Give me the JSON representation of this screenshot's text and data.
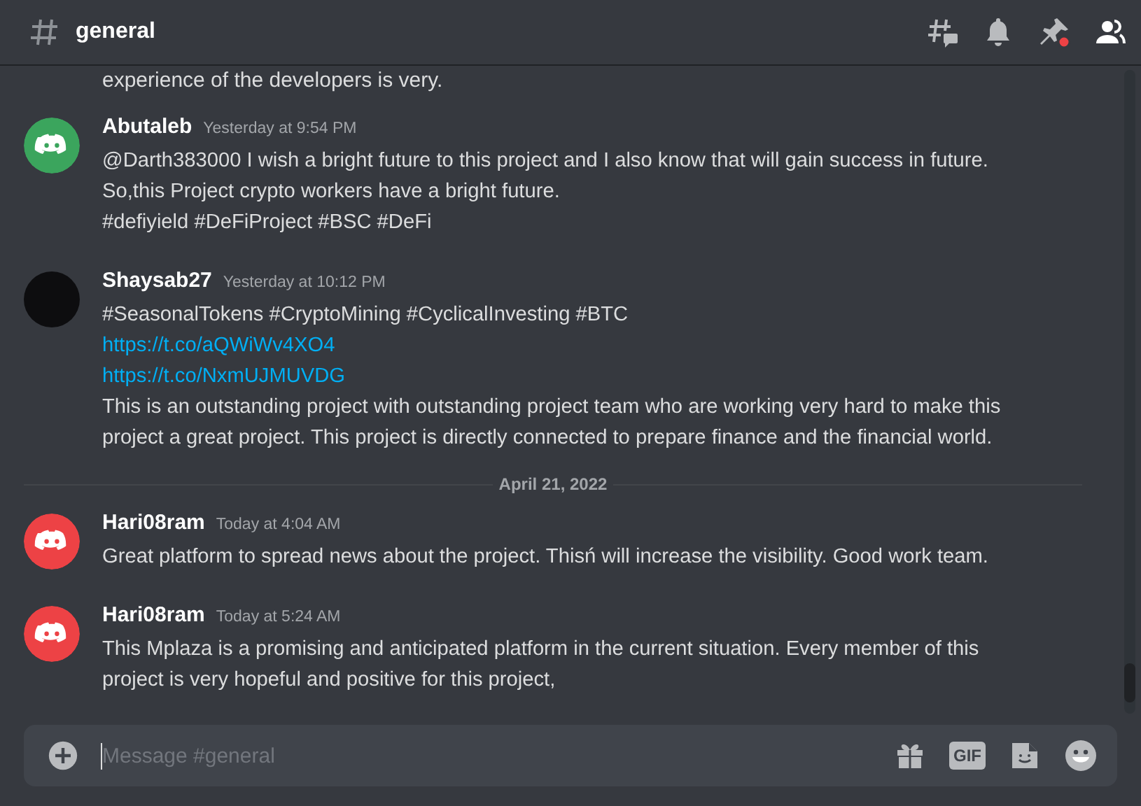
{
  "channel": {
    "name": "general"
  },
  "cut_line": "experience of the developers is very.",
  "feed": [
    {
      "kind": "message",
      "author": "Abutaleb",
      "time": "Yesterday at 9:54 PM",
      "avatar": {
        "kind": "logo",
        "color": "#3ba55d"
      },
      "lines": [
        {
          "kind": "text",
          "text": "@Darth383000 I wish a bright future to this project and I also know that will gain success in future."
        },
        {
          "kind": "text",
          "text": "So,this Project crypto workers have a bright future."
        },
        {
          "kind": "text",
          "text": "#defiyield #DeFiProject #BSC #DeFi"
        }
      ]
    },
    {
      "kind": "message",
      "author": "Shaysab27",
      "time": "Yesterday at 10:12 PM",
      "avatar": {
        "kind": "photo"
      },
      "lines": [
        {
          "kind": "text",
          "text": "#SeasonalTokens #CryptoMining #CyclicalInvesting #BTC"
        },
        {
          "kind": "link",
          "text": "https://t.co/aQWiWv4XO4"
        },
        {
          "kind": "link",
          "text": "https://t.co/NxmUJMUVDG"
        },
        {
          "kind": "text",
          "text": "This is an outstanding project with outstanding project team who are working very hard to make this project a great project. This project is directly connected to prepare finance and the financial world."
        }
      ]
    },
    {
      "kind": "date_divider",
      "text": "April 21, 2022"
    },
    {
      "kind": "message",
      "author": "Hari08ram",
      "time": "Today at 4:04 AM",
      "avatar": {
        "kind": "logo",
        "color": "#ed4245"
      },
      "lines": [
        {
          "kind": "text",
          "text": "Great platform to spread news about the project. Thisń will increase the visibility. Good work team."
        }
      ]
    },
    {
      "kind": "message",
      "author": "Hari08ram",
      "time": "Today at 5:24 AM",
      "avatar": {
        "kind": "logo",
        "color": "#ed4245"
      },
      "lines": [
        {
          "kind": "text",
          "text": "This Mplaza is a promising and anticipated platform in the current situation. Every member of this project is very hopeful and positive for this project,"
        }
      ]
    }
  ],
  "composer": {
    "placeholder": "Message #general",
    "gif_label": "GIF"
  }
}
